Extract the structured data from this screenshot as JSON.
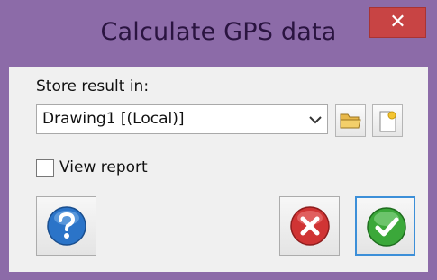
{
  "window": {
    "title": "Calculate GPS data",
    "close_symbol": "✕"
  },
  "form": {
    "store_label": "Store result in:",
    "store_value": "Drawing1 [(Local)]",
    "view_report_label": "View report",
    "view_report_checked": false
  },
  "icons": {
    "dropdown": "chevron-down-icon",
    "browse": "folder-icon",
    "new": "new-document-icon",
    "help": "help-icon",
    "cancel": "cancel-icon",
    "ok": "ok-icon"
  },
  "colors": {
    "frame": "#8c6ba8",
    "close_button": "#c84444",
    "help_blue": "#2b74c8",
    "cancel_red": "#d03434",
    "ok_green": "#3ba83a",
    "focus": "#3c8fd8"
  }
}
